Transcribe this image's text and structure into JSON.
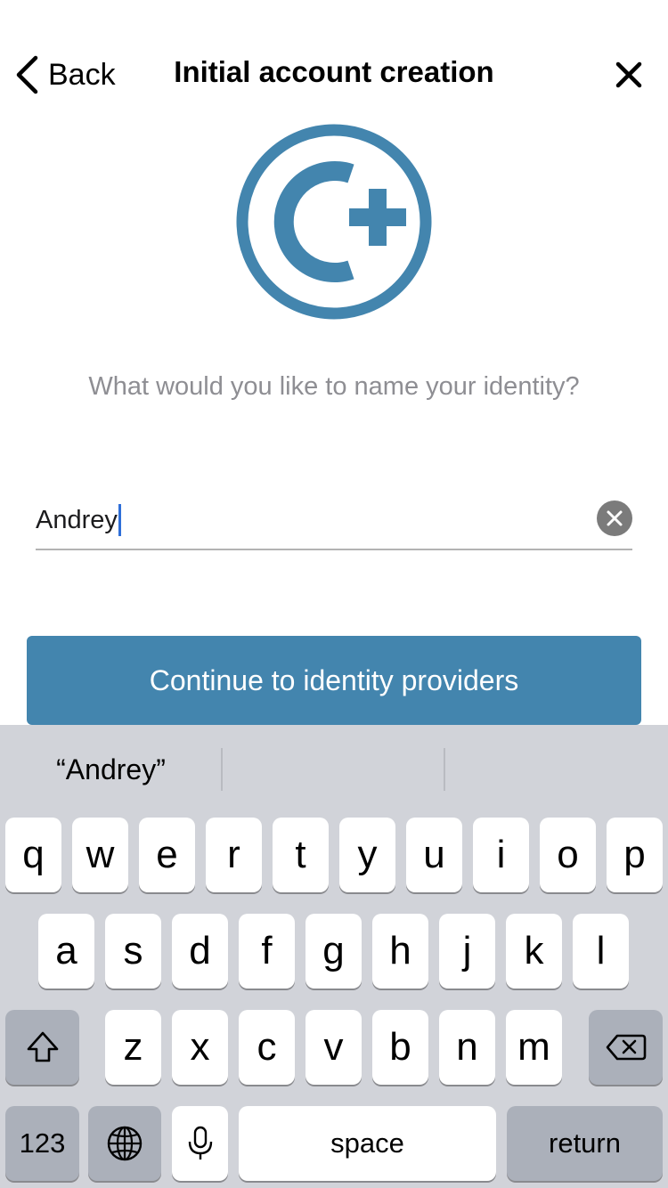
{
  "header": {
    "back_label": "Back",
    "title": "Initial account creation"
  },
  "prompt": "What would you like to name your identity?",
  "name_field": {
    "value": "Andrey"
  },
  "continue_label": "Continue to identity providers",
  "colors": {
    "accent": "#4385ae",
    "caret": "#2f6fd8",
    "keyboard_bg": "#d1d3d9"
  },
  "keyboard": {
    "suggestions": [
      "“Andrey”",
      "",
      ""
    ],
    "row1": [
      "q",
      "w",
      "e",
      "r",
      "t",
      "y",
      "u",
      "i",
      "o",
      "p"
    ],
    "row2": [
      "a",
      "s",
      "d",
      "f",
      "g",
      "h",
      "j",
      "k",
      "l"
    ],
    "row3": [
      "z",
      "x",
      "c",
      "v",
      "b",
      "n",
      "m"
    ],
    "numbers_label": "123",
    "space_label": "space",
    "return_label": "return",
    "icons": {
      "shift": "shift-icon",
      "delete": "backspace-icon",
      "globe": "globe-icon",
      "mic": "microphone-icon"
    }
  }
}
